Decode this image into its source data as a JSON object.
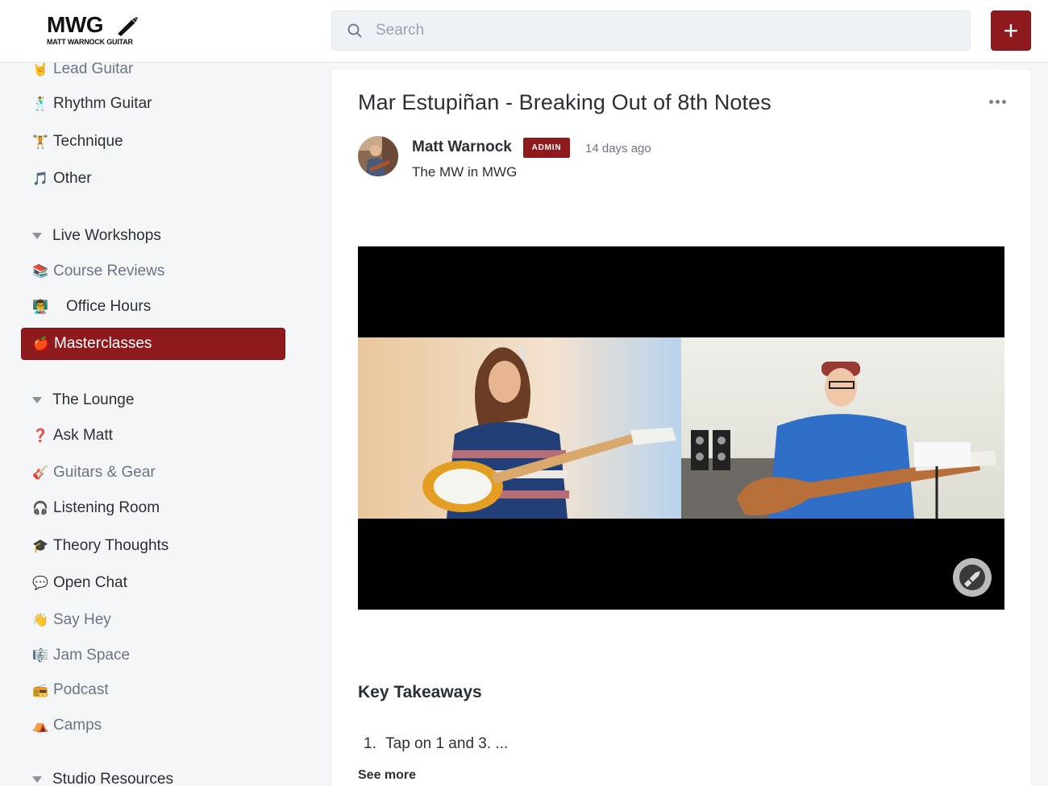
{
  "brand": {
    "logo_text": "MWG",
    "logo_subtext": "MATT WARNOCK GUITAR"
  },
  "header": {
    "search_placeholder": "Search",
    "search_value": "",
    "add_button_label": "+"
  },
  "sidebar": {
    "items": [
      {
        "emoji": "🤘",
        "label": "Lead Guitar"
      },
      {
        "emoji": "🕺",
        "label": "Rhythm Guitar"
      },
      {
        "emoji": "🏋",
        "label": "Technique"
      },
      {
        "emoji": "🎵",
        "label": "Other"
      }
    ],
    "groups": [
      {
        "label": "Live Workshops",
        "items": [
          {
            "emoji": "📚",
            "label": "Course Reviews"
          },
          {
            "emoji": "👨‍🏫",
            "label": "Office Hours"
          },
          {
            "emoji": "🍎",
            "label": "Masterclasses",
            "active": true
          }
        ]
      },
      {
        "label": "The Lounge",
        "items": [
          {
            "emoji": "❓",
            "label": "Ask Matt"
          },
          {
            "emoji": "🎸",
            "label": "Guitars & Gear"
          },
          {
            "emoji": "🎧",
            "label": "Listening Room"
          },
          {
            "emoji": "🎓",
            "label": "Theory Thoughts"
          },
          {
            "emoji": "💬",
            "label": "Open Chat"
          },
          {
            "emoji": "👋",
            "label": "Say Hey"
          },
          {
            "emoji": "🎼",
            "label": "Jam Space"
          },
          {
            "emoji": "📻",
            "label": "Podcast"
          },
          {
            "emoji": "⛺",
            "label": "Camps"
          }
        ]
      },
      {
        "label": "Studio Resources",
        "items": []
      }
    ]
  },
  "post": {
    "title": "Mar Estupiñan - Breaking Out of 8th Notes",
    "author": {
      "name": "Matt Warnock",
      "badge": "ADMIN",
      "tagline": "The MW in MWG"
    },
    "time_ago": "14 days ago",
    "section_title": "Key Takeaways",
    "list": [
      {
        "number": "1.",
        "text": "Tap on 1 and 3. ..."
      }
    ],
    "see_more": "See more"
  },
  "colors": {
    "accent": "#8e1a1e",
    "sidebar_bg": "#f5f6f8",
    "card_bg": "#ffffff"
  }
}
